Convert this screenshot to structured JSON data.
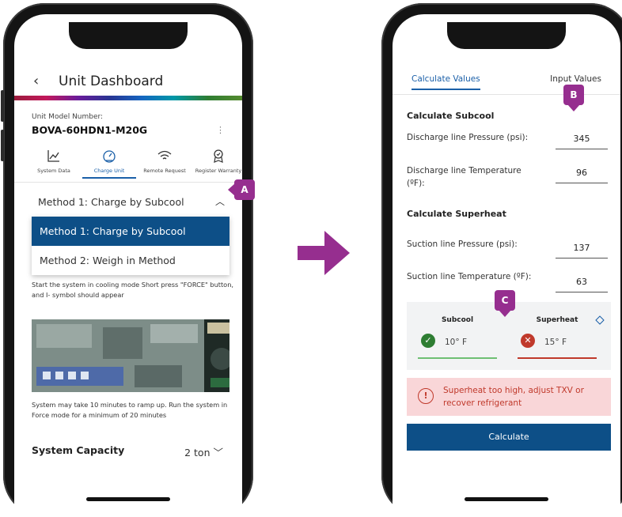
{
  "left_screen": {
    "title": "Unit Dashboard",
    "back_icon": "‹",
    "model_number_label": "Unit Model Number:",
    "model_number_value": "BOVA-60HDN1-M20G",
    "nav": [
      {
        "label": "System Data",
        "icon": "chart-icon"
      },
      {
        "label": "Charge Unit",
        "icon": "gauge-icon"
      },
      {
        "label": "Remote Request",
        "icon": "wifi-icon"
      },
      {
        "label": "Register Warranty",
        "icon": "badge-icon"
      }
    ],
    "method_selected": "Method 1: Charge by Subcool",
    "dropdown_options": [
      "Method 1: Charge by Subcool",
      "Method 2: Weigh in Method"
    ],
    "instruction_text": "Start the system in cooling mode Short press \"FORCE\" button, and I- symbol should appear",
    "ramp_text": "System may take 10 minutes to ramp up. Run the system in Force mode for a minimum of 20 minutes",
    "capacity_label": "System Capacity",
    "capacity_value": "2 ton"
  },
  "right_screen": {
    "tabs": [
      "Calculate Values",
      "Input Values"
    ],
    "subcool_title": "Calculate Subcool",
    "discharge_pressure_label": "Discharge line Pressure (psi):",
    "discharge_pressure_value": "345",
    "discharge_temp_label": "Discharge line Temperature (ºF):",
    "discharge_temp_value": "96",
    "superheat_title": "Calculate Superheat",
    "suction_pressure_label": "Suction line Pressure (psi):",
    "suction_pressure_value": "137",
    "suction_temp_label": "Suction line Temperature (ºF):",
    "suction_temp_value": "63",
    "subcool_result_title": "Subcool",
    "subcool_result_value": "10° F",
    "superheat_result_title": "Superheat",
    "superheat_result_value": "15° F",
    "alert_text": "Superheat too high, adjust TXV or recover refrigerant",
    "calculate_label": "Calculate"
  },
  "badges": {
    "a": "A",
    "b": "B",
    "c": "C"
  },
  "colors": {
    "brand_blue": "#0d4f87",
    "badge_purple": "#962e8f",
    "success_green": "#2e7d32",
    "error_red": "#c0392b"
  }
}
